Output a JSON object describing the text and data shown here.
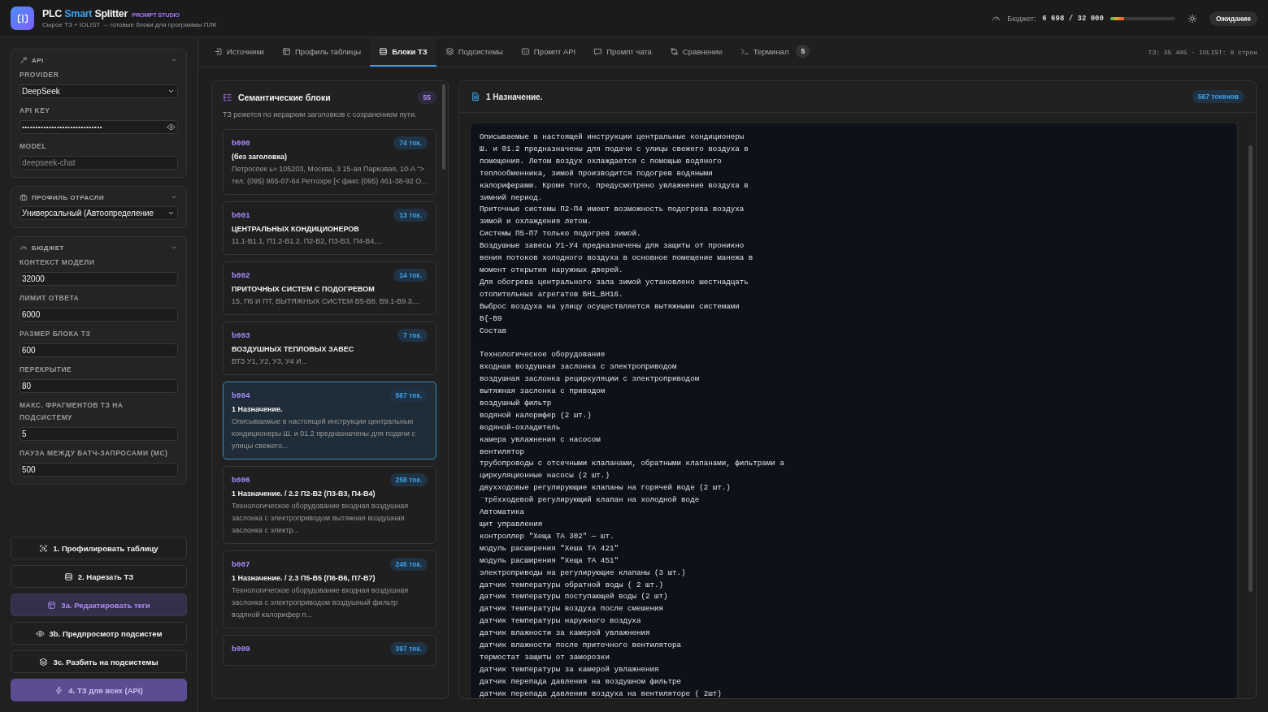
{
  "app": {
    "title_parts": [
      "PLC ",
      "Smart",
      " Splitter"
    ],
    "badge": "PROMPT STUDIO",
    "subtitle": "Сырое ТЗ + IOLIST → готовые блоки для программы ПЛК"
  },
  "header": {
    "budget_label": "Бюджет:",
    "budget_value": "6 698 / 32 000",
    "level": 0.21,
    "status": "Ожидание"
  },
  "sidebar": {
    "sections": [
      {
        "title": "API",
        "fields": [
          {
            "label": "PROVIDER",
            "kind": "select",
            "value": "DeepSeek"
          },
          {
            "label": "API KEY",
            "kind": "secret",
            "value": "••••••••••••••••••••••••••••••"
          },
          {
            "label": "MODEL",
            "kind": "text",
            "placeholder": "deepseek-chat"
          }
        ]
      },
      {
        "title": "ПРОФИЛЬ ОТРАСЛИ",
        "fields": [
          {
            "kind": "select",
            "value": "Универсальный (Автоопределение"
          }
        ]
      },
      {
        "title": "БЮДЖЕТ",
        "fields": [
          {
            "label": "КОНТЕКСТ МОДЕЛИ",
            "kind": "text",
            "value": "32000"
          },
          {
            "label": "ЛИМИТ ОТВЕТА",
            "kind": "text",
            "value": "6000"
          },
          {
            "label": "РАЗМЕР БЛОКА ТЗ",
            "kind": "text",
            "value": "600"
          },
          {
            "label": "ПЕРЕКРЫТИЕ",
            "kind": "text",
            "value": "80"
          },
          {
            "label": "МАКС. ФРАГМЕНТОВ ТЗ НА ПОДСИСТЕМУ",
            "kind": "text",
            "value": "5"
          },
          {
            "label": "ПАУЗА МЕЖДУ БАТЧ-ЗАПРОСАМИ (МС)",
            "kind": "text",
            "value": "500"
          }
        ]
      }
    ],
    "actions": [
      {
        "label": "1. Профилировать таблицу",
        "kind": "plain",
        "selected": false,
        "disabled": false
      },
      {
        "label": "2. Нарезать ТЗ",
        "kind": "plain",
        "selected": false,
        "disabled": false
      },
      {
        "label": "3a. Редактировать теги",
        "kind": "plain",
        "selected": true,
        "disabled": false
      },
      {
        "label": "3b. Предпросмотр подсистем",
        "kind": "plain",
        "selected": false,
        "disabled": false
      },
      {
        "label": "3c. Разбить на подсистемы",
        "kind": "plain",
        "selected": false,
        "disabled": false
      },
      {
        "label": "4. ТЗ для всех (API)",
        "kind": "primary",
        "selected": false,
        "disabled": true
      }
    ]
  },
  "tabs": [
    {
      "label": "Источники",
      "selected": false
    },
    {
      "label": "Профиль таблицы",
      "selected": false
    },
    {
      "label": "Блоки ТЗ",
      "selected": true
    },
    {
      "label": "Подсистемы",
      "selected": false
    },
    {
      "label": "Промпт API",
      "selected": false
    },
    {
      "label": "Промпт чата",
      "selected": false
    },
    {
      "label": "Сравнение",
      "selected": false
    },
    {
      "label": "Терминал",
      "selected": false,
      "count": "5"
    }
  ],
  "tab_info": "ТЗ: 35 405 · IOLIST: 0 строк",
  "blocks_panel": {
    "title": "Семантические блоки",
    "count": "55",
    "description": "ТЗ режется по иерархии заголовков с сохранением пути.",
    "blocks": [
      {
        "code": "b000",
        "tokens": "74 ток.",
        "title": "(без заголовка)",
        "snippet": "Петроспек ь» 105203, Москва, 3 15-ая Парковая, 10-А “> тел. (095) 965-07-64 Ретгохре [< факс (095) 461-38-92 О...",
        "selected": false
      },
      {
        "code": "b001",
        "tokens": "13 ток.",
        "title": "ЦЕНТРАЛЬНЫХ КОНДИЦИОНЕРОВ",
        "snippet": "11.1-В1.1, П1.2-В1.2, П2-В2, П3-В3, П4-В4,...",
        "selected": false
      },
      {
        "code": "b002",
        "tokens": "14 ток.",
        "title": "ПРИТОЧНЫХ СИСТЕМ С ПОДОГРЕВОМ",
        "snippet": "15, П6 И ПТ, ВЫТЯЖНЫХ СИСТЕМ В5-В8, В9.1-В9.3,...",
        "selected": false
      },
      {
        "code": "b003",
        "tokens": "7 ток.",
        "title": "ВОЗДУШНЫХ ТЕПЛОВЫХ ЗАВЕС",
        "snippet": "ВТЗ У1, У2, У3, У4 И...",
        "selected": false
      },
      {
        "code": "b004",
        "tokens": "567 ток.",
        "title": "1 Назначение.",
        "snippet": "Описываемые в настоящей инструкции центральные кондиционеры Ш. и 01.2 предназначены для подачи с улицы свежего...",
        "selected": true
      },
      {
        "code": "b006",
        "tokens": "258 ток.",
        "title": "1 Назначение. / 2.2 П2-В2 (П3-В3, П4-В4)",
        "snippet": "Технологическое оборудование входная воздушная заслонка с электроприводом вытяжная воздушная заслонка с электр...",
        "selected": false
      },
      {
        "code": "b007",
        "tokens": "246 ток.",
        "title": "1 Назначение. / 2.3 П5-В5 (П6-В6, П7-В7)",
        "snippet": "Технологическое оборудование входная воздушная заслонка с электроприводом воздушный фильтр водяной калорифер п...",
        "selected": false
      },
      {
        "code": "b009",
        "tokens": "397 ток.",
        "selected": false
      }
    ]
  },
  "document": {
    "title": "1 Назначение.",
    "tokens": "567 токенов",
    "text": "Описываемые в настоящей инструкции центральные кондиционеры\nШ. и 01.2 предназначены для подачи с улицы свежего воздуха в\nпомещения. Летом воздух охлаждается с помощью водяного\nтеплообменника, зимой производится подогрев водяными\nкалориферами. Кроме того, предусмотрено увлажнение воздуха в\nзимний период.\nПриточные системы П2-П4 имеют возможность подогрева воздуха\nзимой и охлаждения летом.\nСистемы П5-П7 только подогрев зимой.\nВоздушные завесы У1-У4 предназначены для защиты от проникно\nвения потоков холодного воздуха в основное помещение манежа в\nмомент открытия наружных дверей.\nДля обогрева центрального зала зимой установлено шестнадцать\nотопительных агрегатов ВН1_ВН16.\nВыброс воздуха на улицу осуществляется вытяжными системами\nВ{-В9\nСостав\n\nТехнологическое оборудование\nвходная воздушная заслонка с электроприводом\nвоздушная заслонка рециркуляции с электроприводом\nвытяжная заслонка с приводом\nвоздушный фильтр\nводяной калорифер (2 шт.)\nводяной-охладитель\nкамера увлажнения с насосом\nвентилятор\nтрубопроводы с отсечными клапанами, обратными клапанами, фильтрами а\nциркуляционные насосы (2 шт.)\nдвухходовые регулирующие клапаны на горячей воде (2 шт.)\n`трёхходевой регулирующий клапан на холодной воде\nАвтоматика\nщит управления\nконтроллер \"Хеща ТА 302\" — шт.\nмодуль расширения \"Хеша ТА 421\"\nмодуль расширения \"Хеща ТА 451\"\nэлектроприводы на регулирующие клапаны (3 шт.)\nдатчик температуры обратной воды ( 2 шт.)\nдатчик температуры поступающей воды (2 шт)\nдатчик температуры воздуха после смешения\nдатчик температуры наружного воздуха\nдатчик влажности за камерой увлажнения\nдатчик влажности после приточного вентилятора\nтермостат защиты от заморозки\nдатчик температуры за камерой увлажнения\nдатчик перепада давления на воздушном фильтре\nдатчик перепада давления воздуха на вентиляторе ( 2шт)"
  }
}
